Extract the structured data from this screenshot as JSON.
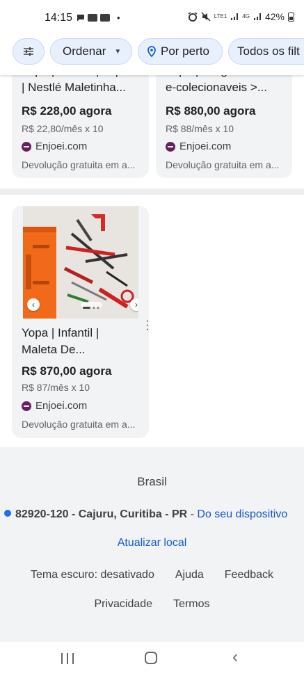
{
  "status_bar": {
    "time": "14:15",
    "battery": "42%",
    "signal_text": "LTE1",
    "network": "4G"
  },
  "chips": {
    "filter_icon": "tune-icon",
    "order_label": "Ordenar",
    "near_label": "Por perto",
    "all_label": "Todos os filt"
  },
  "products_top": [
    {
      "title_line1": "Yopa | Infantil | Yopa",
      "title_line2": "| Nestlé Maletinha...",
      "price": "R$ 228,00 agora",
      "installment": "R$ 22,80/mês x 10",
      "seller": "Enjoei.com",
      "returns": "Devolução gratuita em a..."
    },
    {
      "title_line1": "Yopa | antiguidades",
      "title_line2": "e-colecionaveis >...",
      "price": "R$ 880,00 agora",
      "installment": "R$ 88/mês x 10",
      "seller": "Enjoei.com",
      "returns": "Devolução gratuita em a..."
    }
  ],
  "product_featured": {
    "title_line1": "Yopa | Infantil |",
    "title_line2": "Maleta De...",
    "price": "R$ 870,00 agora",
    "installment": "R$ 87/mês x 10",
    "seller": "Enjoei.com",
    "returns": "Devolução gratuita em a..."
  },
  "footer": {
    "country": "Brasil",
    "location": "82920-120 - Cajuru, Curitiba - PR",
    "separator": " - ",
    "location_source": "Do seu dispositivo",
    "update_location": "Atualizar local",
    "dark_theme": "Tema escuro: desativado",
    "help": "Ajuda",
    "feedback": "Feedback",
    "privacy": "Privacidade",
    "terms": "Termos"
  },
  "colors": {
    "accent": "#1558d6",
    "chip_bg": "#e8f0fe",
    "card_bg": "#f1f3f4",
    "seller_logo": "#6c1d5f"
  }
}
